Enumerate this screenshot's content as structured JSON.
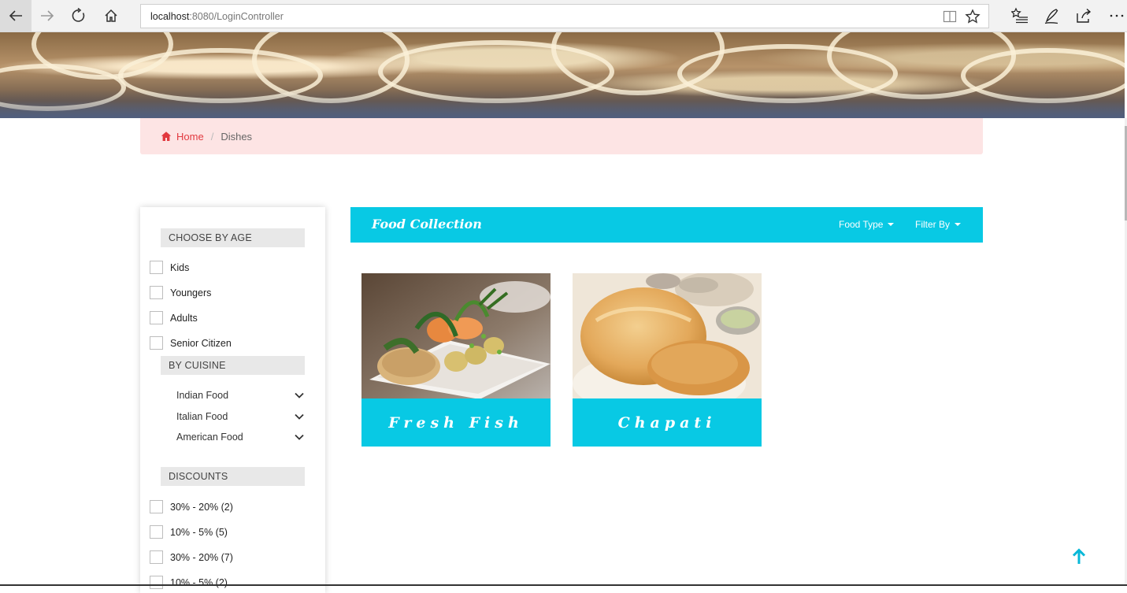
{
  "browser": {
    "url_host": "localhost",
    "url_rest": ":8080/LoginController",
    "icons": [
      "back-arrow-icon",
      "forward-arrow-icon",
      "reload-icon",
      "home-icon",
      "reading-view-icon",
      "favorite-star-icon",
      "favorites-list-icon",
      "pen-icon",
      "share-icon",
      "more-icon"
    ]
  },
  "breadcrumb": {
    "home": "Home",
    "current": "Dishes"
  },
  "sidebar": {
    "age_heading": "CHOOSE BY AGE",
    "age_options": [
      "Kids",
      "Youngers",
      "Adults",
      "Senior Citizen"
    ],
    "cuisine_heading": "BY CUISINE",
    "cuisines": [
      "Indian Food",
      "Italian Food",
      "American Food"
    ],
    "discount_heading": "DISCOUNTS",
    "discounts": [
      "30% - 20% (2)",
      "10% - 5% (5)",
      "30% - 20% (7)",
      "10% - 5% (2)"
    ]
  },
  "collection": {
    "title": "Food Collection",
    "food_type": "Food Type",
    "filter_by": "Filter By"
  },
  "dishes": [
    {
      "name": "Fresh Fish"
    },
    {
      "name": "Chapati"
    }
  ],
  "colors": {
    "accent": "#08c9e4",
    "breadcrumb_bg": "#fde4e4",
    "home_link": "#e2393f"
  }
}
